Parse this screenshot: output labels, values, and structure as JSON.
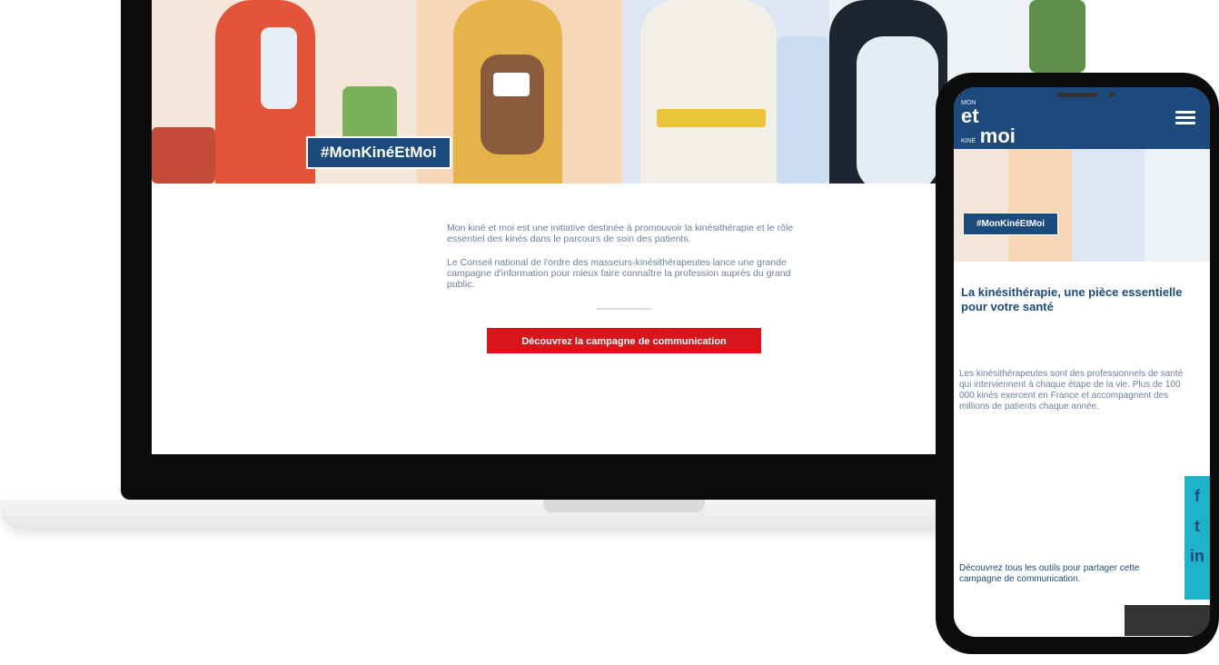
{
  "desktop": {
    "hashtag": "#MonKinéEtMoi",
    "paragraphs": [
      "Mon kiné et moi est une initiative destinée à promouvoir la kinésithérapie et le rôle essentiel des kinés dans le parcours de soin des patients.",
      "Le Conseil national de l'ordre des masseurs-kinésithérapeutes lance une grande campagne d'information pour mieux faire connaître la profession auprès du grand public."
    ],
    "cta_label": "Découvrez la campagne de communication"
  },
  "mobile": {
    "logo_small_top": "MON",
    "logo_small_bottom": "KINÉ",
    "logo_et": "et",
    "logo_moi": "moi",
    "hashtag": "#MonKinéEtMoi",
    "title": "La kinésithérapie, une pièce essentielle pour votre santé",
    "meta": "",
    "body": "Les kinésithérapeutes sont des professionnels de santé qui interviennent à chaque étape de la vie. Plus de 100 000 kinés exercent en France et accompagnent des millions de patients chaque année.",
    "body2": "Découvrez tous les outils pour partager cette campagne de communication.",
    "social_icons": [
      "f",
      "t",
      "in"
    ]
  }
}
